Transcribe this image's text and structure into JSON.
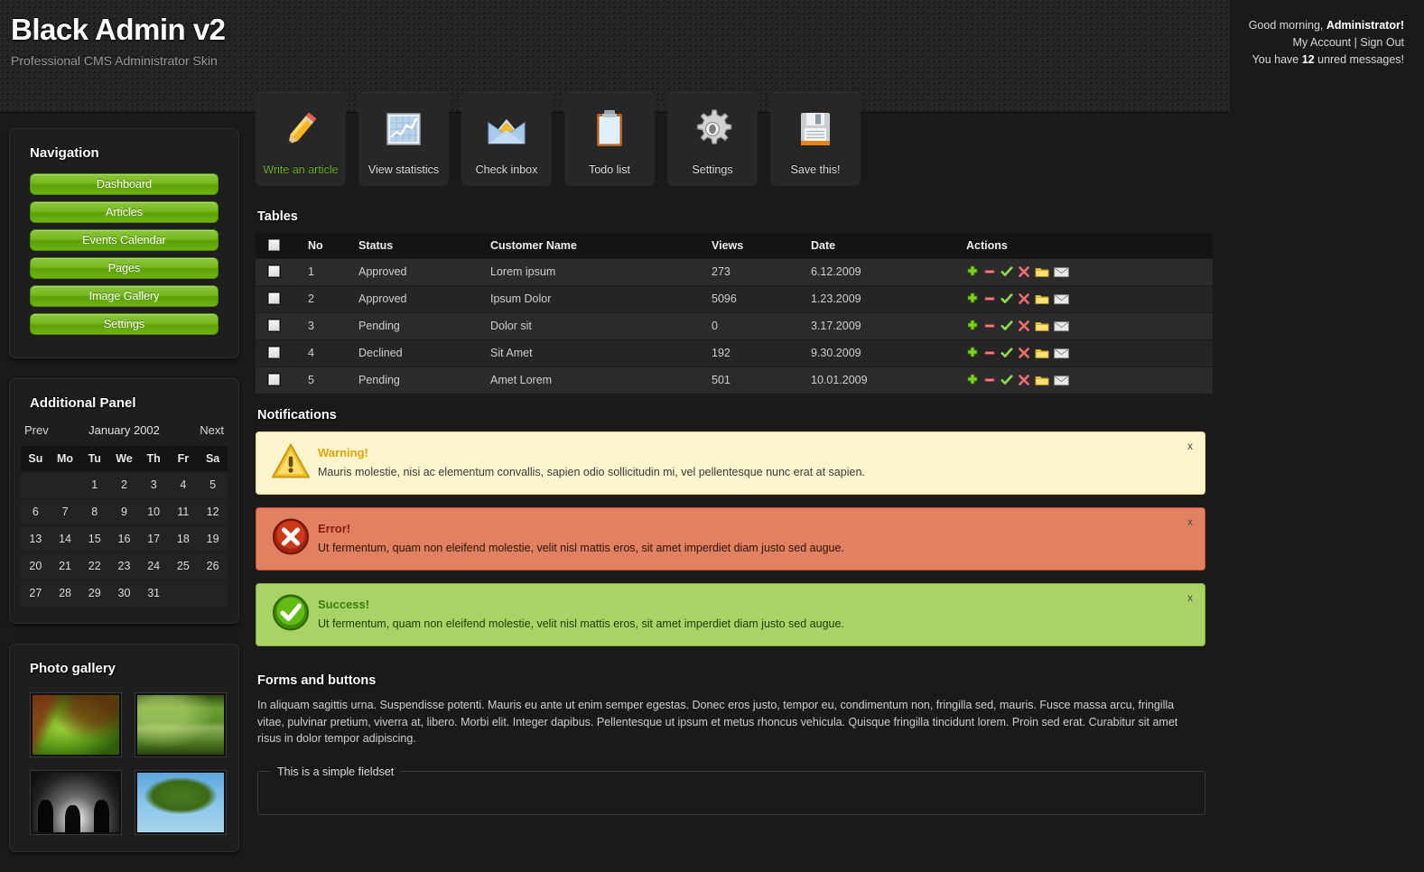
{
  "header": {
    "title": "Black Admin v2",
    "subtitle": "Professional CMS Administrator Skin",
    "greeting": "Good morning, Administrator!",
    "greeting_name": "Administrator!",
    "greeting_prefix": "Good morning, ",
    "my_account": "My Account",
    "separator": " | ",
    "sign_out": "Sign Out",
    "messages_prefix": "You have ",
    "messages_count": "12",
    "messages_suffix": " unred messages!"
  },
  "sidebar": {
    "navigation": {
      "title": "Navigation",
      "items": [
        {
          "label": "Dashboard"
        },
        {
          "label": "Articles"
        },
        {
          "label": "Events Calendar"
        },
        {
          "label": "Pages"
        },
        {
          "label": "Image Gallery"
        },
        {
          "label": "Settings"
        }
      ]
    },
    "additional_panel": {
      "title": "Additional Panel",
      "calendar": {
        "prev": "Prev",
        "month": "January 2002",
        "next": "Next",
        "weekdays": [
          "Su",
          "Mo",
          "Tu",
          "We",
          "Th",
          "Fr",
          "Sa"
        ],
        "weeks": [
          [
            "",
            "",
            "1",
            "2",
            "3",
            "4",
            "5"
          ],
          [
            "6",
            "7",
            "8",
            "9",
            "10",
            "11",
            "12"
          ],
          [
            "13",
            "14",
            "15",
            "16",
            "17",
            "18",
            "19"
          ],
          [
            "20",
            "21",
            "22",
            "23",
            "24",
            "25",
            "26"
          ],
          [
            "27",
            "28",
            "29",
            "30",
            "31",
            "",
            ""
          ]
        ]
      }
    },
    "photo_gallery": {
      "title": "Photo gallery",
      "photos": [
        {
          "name": "green-leaf-photo"
        },
        {
          "name": "forest-pond-photo"
        },
        {
          "name": "sunset-silhouette-photo"
        },
        {
          "name": "oak-tree-photo"
        }
      ]
    }
  },
  "shortcuts": [
    {
      "label": "Write an article",
      "icon": "pencil-icon",
      "active": true
    },
    {
      "label": "View statistics",
      "icon": "chart-icon",
      "active": false
    },
    {
      "label": "Check inbox",
      "icon": "envelope-icon",
      "active": false
    },
    {
      "label": "Todo list",
      "icon": "clipboard-icon",
      "active": false
    },
    {
      "label": "Settings",
      "icon": "gear-icon",
      "active": false
    },
    {
      "label": "Save this!",
      "icon": "floppy-disk-icon",
      "active": false
    }
  ],
  "tables": {
    "heading": "Tables",
    "columns": [
      "",
      "No",
      "Status",
      "Customer Name",
      "Views",
      "Date",
      "Actions"
    ],
    "rows": [
      {
        "no": "1",
        "status": "Approved",
        "customer": "Lorem ipsum",
        "views": "273",
        "date": "6.12.2009"
      },
      {
        "no": "2",
        "status": "Approved",
        "customer": "Ipsum Dolor",
        "views": "5096",
        "date": "1.23.2009"
      },
      {
        "no": "3",
        "status": "Pending",
        "customer": "Dolor sit",
        "views": "0",
        "date": "3.17.2009"
      },
      {
        "no": "4",
        "status": "Declined",
        "customer": "Sit Amet",
        "views": "192",
        "date": "9.30.2009"
      },
      {
        "no": "5",
        "status": "Pending",
        "customer": "Amet Lorem",
        "views": "501",
        "date": "10.01.2009"
      }
    ],
    "row_actions": [
      "add-icon",
      "remove-icon",
      "approve-icon",
      "delete-icon",
      "folder-icon",
      "mail-icon"
    ]
  },
  "notifications": {
    "heading": "Notifications",
    "close_label": "x",
    "items": [
      {
        "type": "warning",
        "icon": "warning-triangle-icon",
        "title": "Warning!",
        "text": "Mauris molestie, nisi ac elementum convallis, sapien odio sollicitudin mi, vel pellentesque nunc erat at sapien."
      },
      {
        "type": "error",
        "icon": "error-circle-icon",
        "title": "Error!",
        "text": "Ut fermentum, quam non eleifend molestie, velit nisl mattis eros, sit amet imperdiet diam justo sed augue."
      },
      {
        "type": "success",
        "icon": "success-check-icon",
        "title": "Success!",
        "text": "Ut fermentum, quam non eleifend molestie, velit nisl mattis eros, sit amet imperdiet diam justo sed augue."
      }
    ]
  },
  "forms": {
    "heading": "Forms and buttons",
    "paragraph": "In aliquam sagittis urna. Suspendisse potenti. Mauris eu ante ut enim semper egestas. Donec eros justo, tempor eu, condimentum non, fringilla sed, mauris. Fusce massa arcu, fringilla vitae, pulvinar pretium, viverra at, libero. Morbi elit. Integer dapibus. Pellentesque ut ipsum et metus rhoncus vehicula. Quisque fringilla tincidunt lorem. Proin sed erat. Curabitur sit amet risus in dolor tempor adipiscing.",
    "fieldset_legend": "This is a simple fieldset"
  },
  "colors": {
    "accent_green": "#6ab023",
    "button_green": "#76b81c",
    "warning_bg": "#fbf4cd",
    "error_bg": "#e28162",
    "success_bg": "#a9d465",
    "page_bg": "#1a1a1a"
  }
}
